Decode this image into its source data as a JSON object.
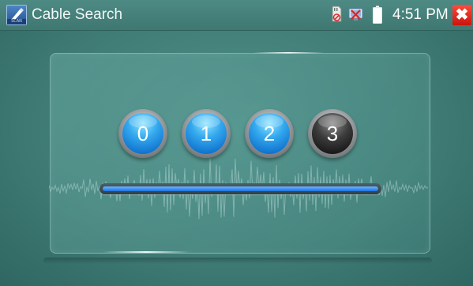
{
  "titlebar": {
    "title": "Cable Search",
    "app_icon": "pencil-icon",
    "app_icon_tag": "SCAN",
    "time": "4:51 PM",
    "status_icons": [
      "sd-card-icon",
      "network-disconnected-icon",
      "battery-icon"
    ],
    "close_icon": "close-icon",
    "accent": "#e22"
  },
  "steps": [
    {
      "label": "0",
      "active": true
    },
    {
      "label": "1",
      "active": true
    },
    {
      "label": "2",
      "active": true
    },
    {
      "label": "3",
      "active": false
    }
  ],
  "progress": {
    "value": 1.0
  }
}
